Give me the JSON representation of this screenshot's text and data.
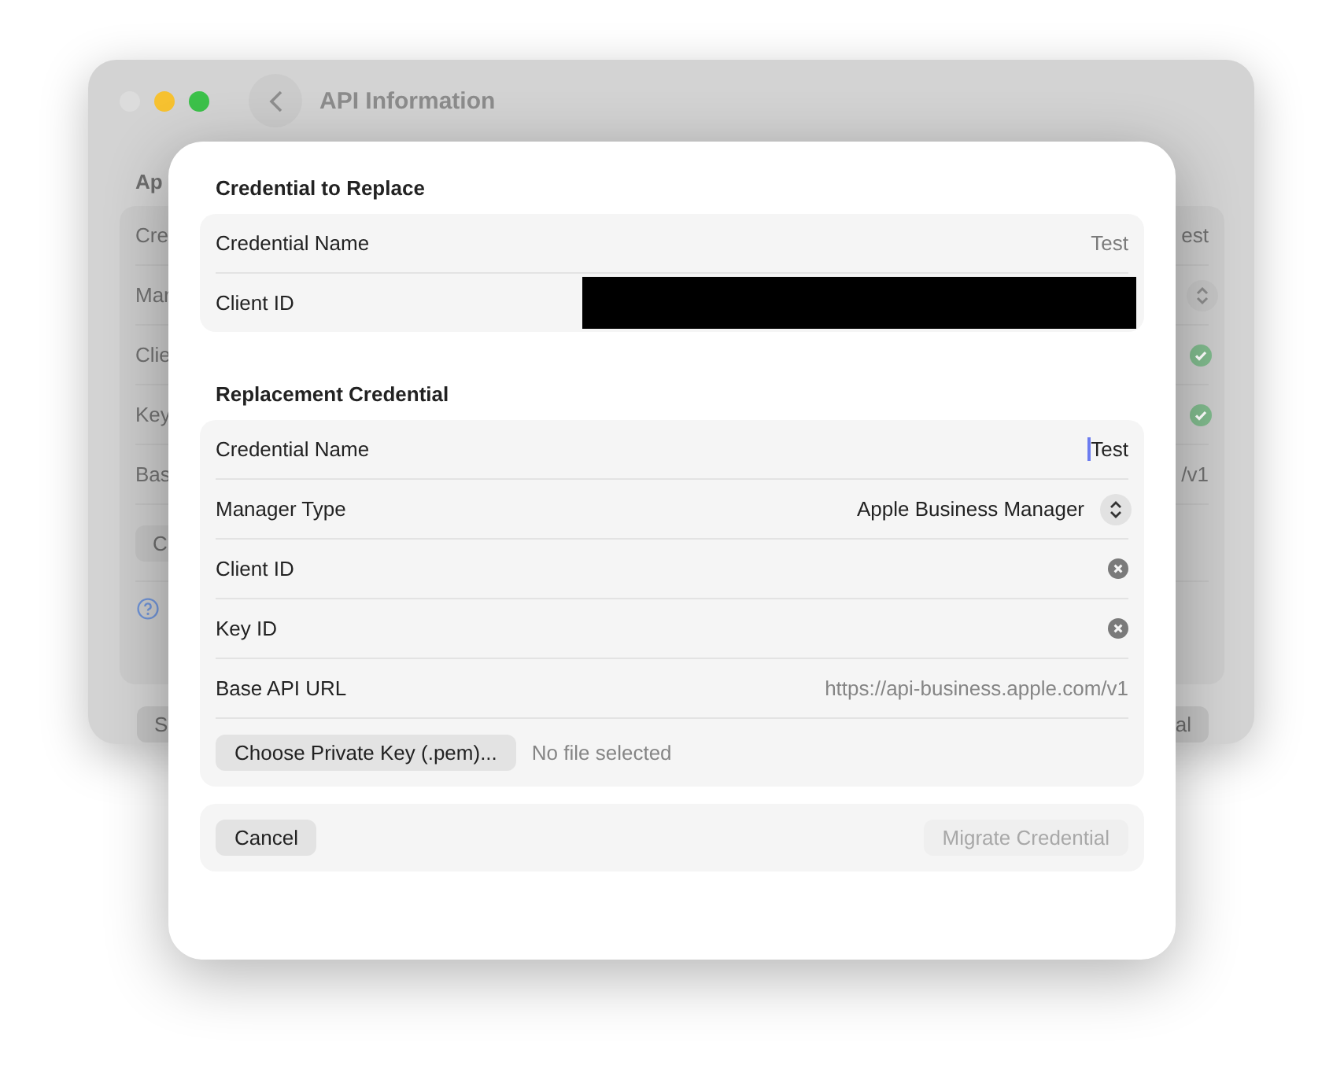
{
  "background_window": {
    "title": "API Information",
    "section_title": "Ap",
    "rows": [
      {
        "kind": "text",
        "label": "Cre",
        "value": "est"
      },
      {
        "kind": "popup",
        "label": "Mar"
      },
      {
        "kind": "check",
        "label": "Clie"
      },
      {
        "kind": "check",
        "label": "Key"
      },
      {
        "kind": "text",
        "label": "Bas",
        "value": "/v1"
      }
    ],
    "button": "C",
    "footer_left_button": "S",
    "footer_right_button": "al"
  },
  "sheet": {
    "sections": [
      {
        "title": "Credential to Replace",
        "rows": [
          {
            "kind": "info",
            "label": "Credential Name",
            "value": "Test"
          },
          {
            "kind": "info",
            "label": "Client ID",
            "redacted": true
          }
        ]
      },
      {
        "title": "Replacement Credential",
        "rows": [
          {
            "kind": "field",
            "label": "Credential Name",
            "value": "Test",
            "focused": true
          },
          {
            "kind": "popup",
            "label": "Manager Type",
            "value": "Apple Business Manager"
          },
          {
            "kind": "field",
            "label": "Client ID",
            "clearable": true
          },
          {
            "kind": "field",
            "label": "Key ID",
            "clearable": true
          },
          {
            "kind": "field",
            "label": "Base API URL",
            "placeholder": "https://api-business.apple.com/v1"
          },
          {
            "kind": "file",
            "button": "Choose Private Key (.pem)...",
            "status": "No file selected"
          }
        ]
      }
    ],
    "buttons": [
      {
        "label": "Cancel",
        "disabled": false
      },
      {
        "label": "Migrate Credential",
        "disabled": true
      }
    ]
  }
}
